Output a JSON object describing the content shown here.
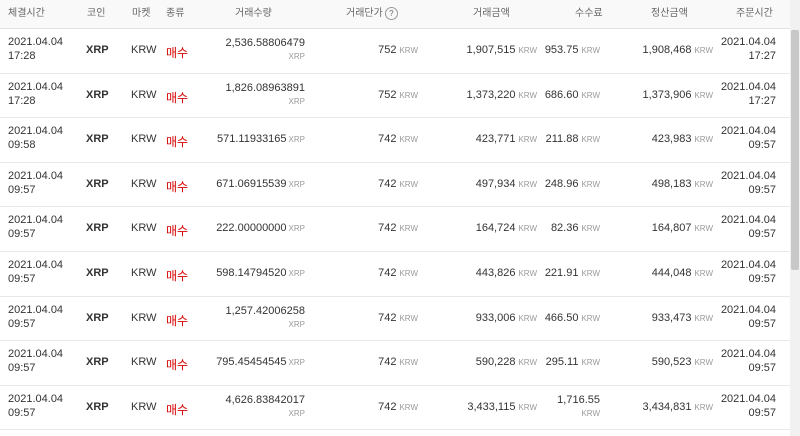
{
  "headers": {
    "exec_time": "체결시간",
    "coin": "코인",
    "market": "마켓",
    "type": "종류",
    "volume": "거래수량",
    "price": "거래단가",
    "price_help": "?",
    "amount": "거래금액",
    "fee": "수수료",
    "settlement": "정산금액",
    "order_time": "주문시간"
  },
  "rows": [
    {
      "date": "2021.04.04",
      "time": "17:28",
      "coin": "XRP",
      "market": "KRW",
      "side": "매수",
      "volume": "2,536.58806479",
      "volume_unit": "XRP",
      "price": "752",
      "price_unit": "KRW",
      "amount": "1,907,515",
      "amount_unit": "KRW",
      "fee": "953.75",
      "fee_unit": "KRW",
      "settle": "1,908,468",
      "settle_unit": "KRW",
      "order_date": "2021.04.04",
      "order_time": "17:27"
    },
    {
      "date": "2021.04.04",
      "time": "17:28",
      "coin": "XRP",
      "market": "KRW",
      "side": "매수",
      "volume": "1,826.08963891",
      "volume_unit": "XRP",
      "price": "752",
      "price_unit": "KRW",
      "amount": "1,373,220",
      "amount_unit": "KRW",
      "fee": "686.60",
      "fee_unit": "KRW",
      "settle": "1,373,906",
      "settle_unit": "KRW",
      "order_date": "2021.04.04",
      "order_time": "17:27"
    },
    {
      "date": "2021.04.04",
      "time": "09:58",
      "coin": "XRP",
      "market": "KRW",
      "side": "매수",
      "volume": "571.11933165",
      "volume_unit": "XRP",
      "price": "742",
      "price_unit": "KRW",
      "amount": "423,771",
      "amount_unit": "KRW",
      "fee": "211.88",
      "fee_unit": "KRW",
      "settle": "423,983",
      "settle_unit": "KRW",
      "order_date": "2021.04.04",
      "order_time": "09:57"
    },
    {
      "date": "2021.04.04",
      "time": "09:57",
      "coin": "XRP",
      "market": "KRW",
      "side": "매수",
      "volume": "671.06915539",
      "volume_unit": "XRP",
      "price": "742",
      "price_unit": "KRW",
      "amount": "497,934",
      "amount_unit": "KRW",
      "fee": "248.96",
      "fee_unit": "KRW",
      "settle": "498,183",
      "settle_unit": "KRW",
      "order_date": "2021.04.04",
      "order_time": "09:57"
    },
    {
      "date": "2021.04.04",
      "time": "09:57",
      "coin": "XRP",
      "market": "KRW",
      "side": "매수",
      "volume": "222.00000000",
      "volume_unit": "XRP",
      "price": "742",
      "price_unit": "KRW",
      "amount": "164,724",
      "amount_unit": "KRW",
      "fee": "82.36",
      "fee_unit": "KRW",
      "settle": "164,807",
      "settle_unit": "KRW",
      "order_date": "2021.04.04",
      "order_time": "09:57"
    },
    {
      "date": "2021.04.04",
      "time": "09:57",
      "coin": "XRP",
      "market": "KRW",
      "side": "매수",
      "volume": "598.14794520",
      "volume_unit": "XRP",
      "price": "742",
      "price_unit": "KRW",
      "amount": "443,826",
      "amount_unit": "KRW",
      "fee": "221.91",
      "fee_unit": "KRW",
      "settle": "444,048",
      "settle_unit": "KRW",
      "order_date": "2021.04.04",
      "order_time": "09:57"
    },
    {
      "date": "2021.04.04",
      "time": "09:57",
      "coin": "XRP",
      "market": "KRW",
      "side": "매수",
      "volume": "1,257.42006258",
      "volume_unit": "XRP",
      "price": "742",
      "price_unit": "KRW",
      "amount": "933,006",
      "amount_unit": "KRW",
      "fee": "466.50",
      "fee_unit": "KRW",
      "settle": "933,473",
      "settle_unit": "KRW",
      "order_date": "2021.04.04",
      "order_time": "09:57"
    },
    {
      "date": "2021.04.04",
      "time": "09:57",
      "coin": "XRP",
      "market": "KRW",
      "side": "매수",
      "volume": "795.45454545",
      "volume_unit": "XRP",
      "price": "742",
      "price_unit": "KRW",
      "amount": "590,228",
      "amount_unit": "KRW",
      "fee": "295.11",
      "fee_unit": "KRW",
      "settle": "590,523",
      "settle_unit": "KRW",
      "order_date": "2021.04.04",
      "order_time": "09:57"
    },
    {
      "date": "2021.04.04",
      "time": "09:57",
      "coin": "XRP",
      "market": "KRW",
      "side": "매수",
      "volume": "4,626.83842017",
      "volume_unit": "XRP",
      "price": "742",
      "price_unit": "KRW",
      "amount": "3,433,115",
      "amount_unit": "KRW",
      "fee": "1,716.55",
      "fee_unit": "KRW",
      "settle": "3,434,831",
      "settle_unit": "KRW",
      "order_date": "2021.04.04",
      "order_time": "09:57"
    }
  ],
  "colors": {
    "buy": "#d60000",
    "unit": "#999999"
  }
}
